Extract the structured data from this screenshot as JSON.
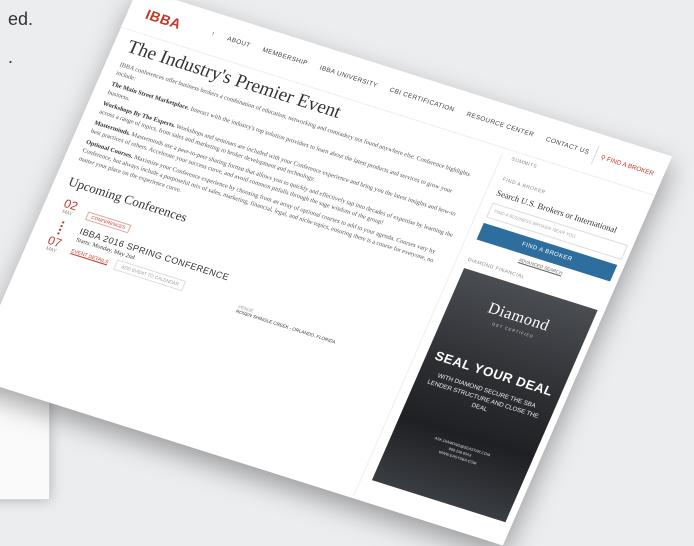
{
  "background": {
    "text": "ed.\n."
  },
  "header": {
    "logo": "IBBA",
    "nav": [
      "↑",
      "ABOUT",
      "MEMBERSHIP",
      "IBBA UNIVERSITY",
      "CBI CERTIFICATION",
      "RESOURCE CENTER",
      "CONTACT US"
    ],
    "find_broker": "FIND A BROKER"
  },
  "main": {
    "title": "The Industry's Premier Event",
    "intro": "IBBA conferences offer business brokers a combination of education, networking and comradery not found anywhere else. Conference highlights include:",
    "items": [
      {
        "label": "The Main Street Marketplace.",
        "text": " Interact with the industry's top solution providers to learn about the latest products and services to grow your business."
      },
      {
        "label": "Workshops By The Experts.",
        "text": " Workshops and seminars are included with your Conference experience and bring you the latest insights and how-to across a range of topics, from sales and marketing to broker development and technology."
      },
      {
        "label": "Masterminds.",
        "text": " Masterminds use a peer-to-peer sharing format that allows you to quickly and effectively tap into decades of expertise by learning the best practices of others. Accelerate your success curve, and avoid common pitfalls through the sage wisdom of the group!"
      },
      {
        "label": "Optional Courses.",
        "text": " Maximize your Conference experience by choosing from an array of optional courses to add to your agenda. Courses vary by Conference, but always include a purposeful mix of sales, marketing, financial, legal, and niche topics, ensuring there is a course for everyone, no matter your place on the experience curve."
      }
    ],
    "upcoming_title": "Upcoming Conferences",
    "conference": {
      "start_day": "02",
      "start_month": "MAY",
      "end_day": "07",
      "end_month": "MAY",
      "tag": "CONFERENCES",
      "title": "IBBA 2016 SPRING CONFERENCE",
      "starts": "Starts: Monday, May 2nd",
      "event_details": "EVENT DETAILS",
      "add_to_calendar": "ADD EVENT TO CALENDAR",
      "venue_label": "VENUE",
      "venue": "ROSEN SHINGLE CREEK - ORLANDO, FLORIDA"
    }
  },
  "sidebar": {
    "summits": "SUMMITS",
    "find_label": "FIND A BROKER",
    "search_title": "Search U.S. Brokers or International",
    "search_placeholder": "FIND A BUSINESS BROKER NEAR YOU",
    "find_button": "FIND A BROKER",
    "advanced": "ADVANCED SEARCH",
    "sponsor": "DIAMOND FINANCIAL",
    "ad": {
      "logo": "Diamond",
      "sub": "GET CERTIFIED",
      "headline": "SEAL YOUR DEAL",
      "text": "WITH DIAMOND SECURE THE SBA LENDER STRUCTURE AND CLOSE THE DEAL",
      "contact": "ASK.DIAMOND@SEASTAR.COM\n888.258.6543\nWWW.EASYSBA.COM"
    }
  }
}
